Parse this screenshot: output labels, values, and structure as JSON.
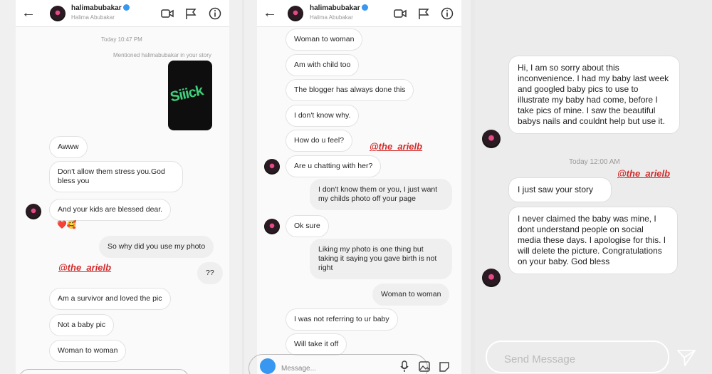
{
  "screen1": {
    "username": "halimabubakar",
    "fullname": "Halima Abubakar",
    "timestamp": "Today 10:47 PM",
    "mention_note": "Mentioned halimabubakar in your story",
    "story_text": "Siiick",
    "messages": [
      "Awww",
      "Don't allow them stress you.God bless you",
      "And your kids are blessed dear.",
      "So why did you use my photo",
      "??",
      "Am a survivor and loved the pic",
      "Not a baby pic",
      "Woman to woman"
    ],
    "reactions": "❤️🥰",
    "tag": "@the_arielb"
  },
  "screen2": {
    "username": "halimabubakar",
    "fullname": "Halima Abubakar",
    "messages": [
      "Woman to woman",
      "Am with child too",
      "The blogger has always done this",
      "I don't know why.",
      "How do u feel?",
      "Are u chatting with her?",
      "I don't know them or you, I just want my childs photo off your page",
      "Ok sure",
      "Liking my photo is one thing but taking it saying you gave birth is not right",
      "Woman to woman",
      "I was not referring to ur baby",
      "Will take it off"
    ],
    "tag": "@the_arielb",
    "input_placeholder": "Message..."
  },
  "screen3": {
    "messages": [
      "Hi, I am so sorry about this inconvenience. I had my baby last week and googled baby pics to use to illustrate my baby had come, before I take pics of mine. I saw the beautiful babys nails and couldnt help but use it.",
      "I just saw your story",
      "I never claimed the baby was mine, I dont understand people on social media these days. I apologise for this. I will delete the picture. Congratulations on your baby. God bless"
    ],
    "timestamp": "Today 12:00 AM",
    "tag": "@the_arielb",
    "send_placeholder": "Send Message"
  },
  "colors": {
    "tag_red": "#d22a2a",
    "verified_blue": "#3897f0",
    "story_green": "#3fd17b"
  }
}
